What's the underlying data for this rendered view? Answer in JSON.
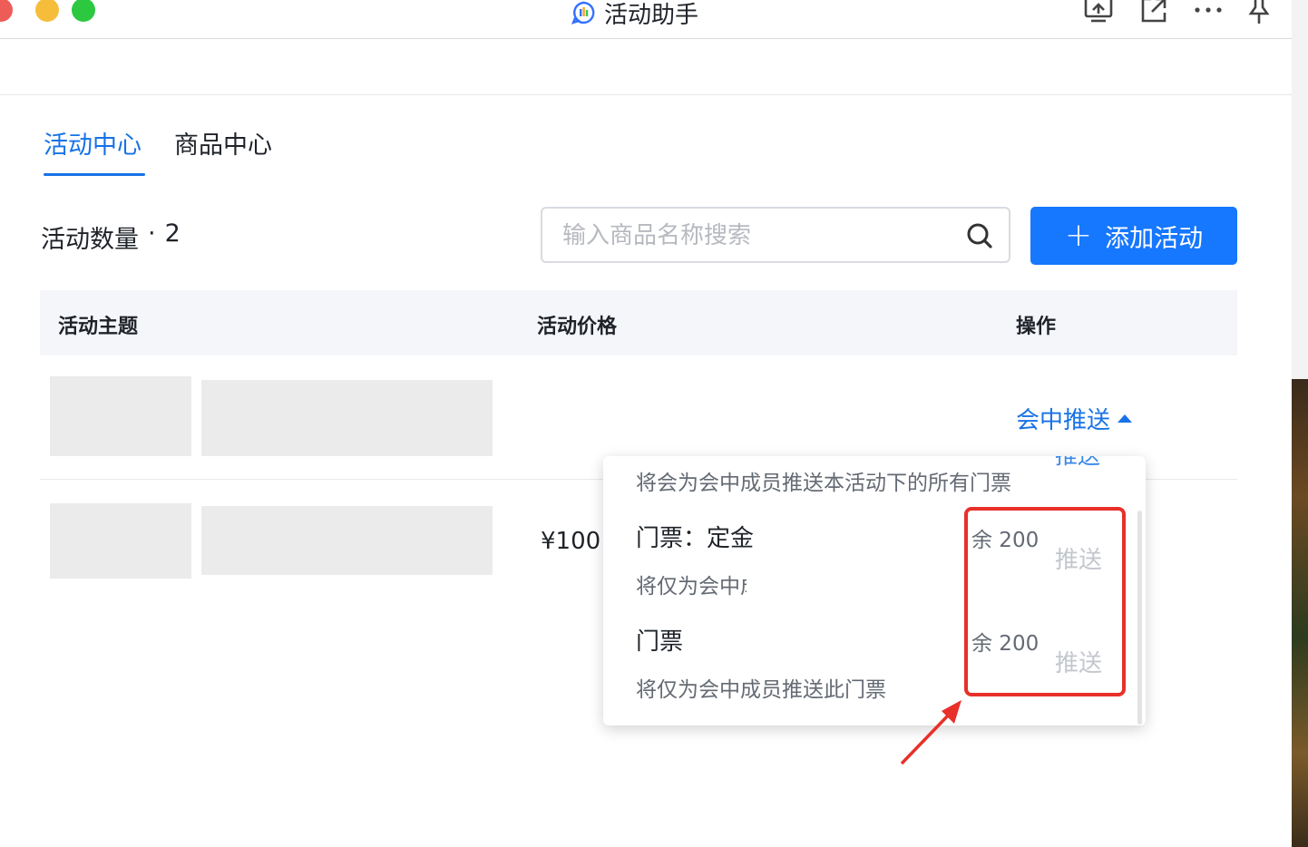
{
  "window": {
    "title": "活动助手"
  },
  "tabs": [
    {
      "label": "活动中心",
      "active": true
    },
    {
      "label": "商品中心",
      "active": false
    }
  ],
  "summary": {
    "count_label": "活动数量",
    "separator": "·",
    "count": "2"
  },
  "search": {
    "placeholder": "输入商品名称搜索",
    "value": ""
  },
  "toolbar": {
    "add_label": "添加活动"
  },
  "table": {
    "headers": [
      "活动主题",
      "活动价格",
      "操作"
    ],
    "rows": [
      {
        "price": "",
        "action": "会中推送"
      },
      {
        "price": "¥100",
        "action": ""
      }
    ]
  },
  "dropdown": {
    "clipped_label": "推送",
    "all_description": "将会为会中成员推送本活动下的所有门票",
    "items": [
      {
        "title": "门票：定金",
        "description": "将仅为会中成员推送此门票",
        "stock": "余 200",
        "action": "推送"
      },
      {
        "title": "门票",
        "description": "将仅为会中成员推送此门票",
        "stock": "余 200",
        "action": "推送"
      }
    ]
  },
  "colors": {
    "accent": "#1677ff",
    "link": "#1772e6",
    "annotation": "#e8302a",
    "placeholder": "#ebebeb"
  }
}
